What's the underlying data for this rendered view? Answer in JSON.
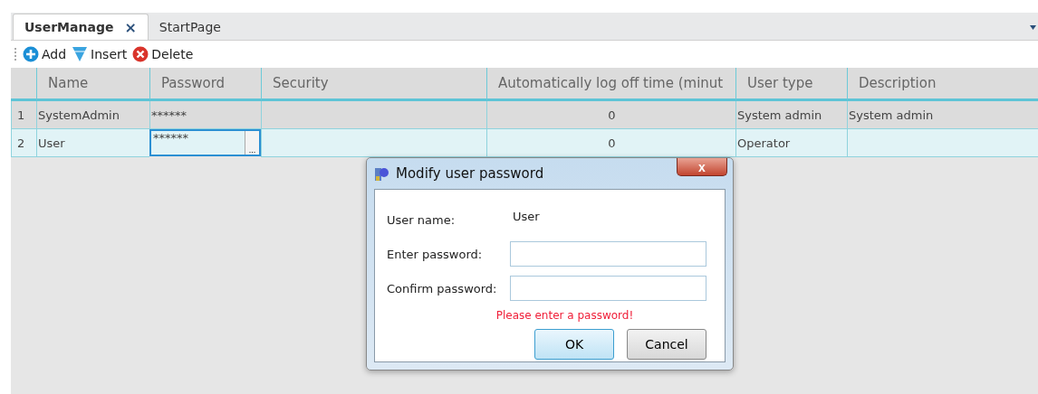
{
  "tabs": [
    {
      "label": "UserManage",
      "selected": true,
      "close": "×"
    },
    {
      "label": "StartPage",
      "selected": false
    }
  ],
  "toolbar": [
    {
      "label": "Add",
      "kind": "add"
    },
    {
      "label": "Insert",
      "kind": "insert"
    },
    {
      "label": "Delete",
      "kind": "delete"
    }
  ],
  "table": {
    "columns": [
      "Name",
      "Password",
      "Security",
      "Automatically log off time (minut",
      "User type",
      "Description"
    ],
    "rows": [
      {
        "index": "1",
        "selected": false,
        "cells": [
          {
            "text": "SystemAdmin",
            "editing": false
          },
          {
            "text": "******",
            "editing": false
          },
          {
            "text": "",
            "editing": false
          },
          {
            "text": "0",
            "editing": false
          },
          {
            "text": "System admin",
            "editing": false
          },
          {
            "text": "System admin",
            "editing": false
          }
        ]
      },
      {
        "index": "2",
        "selected": true,
        "edit_button": "...",
        "cells": [
          {
            "text": "User",
            "editing": false
          },
          {
            "text": "******",
            "editing": true
          },
          {
            "text": "",
            "editing": false
          },
          {
            "text": "0",
            "editing": false
          },
          {
            "text": "Operator",
            "editing": false
          },
          {
            "text": "",
            "editing": false
          }
        ]
      }
    ]
  },
  "dialog": {
    "title": "Modify user password",
    "close": "x",
    "fields": [
      {
        "label": "User name:",
        "kind": "value",
        "value": "User"
      },
      {
        "label": "Enter password:",
        "kind": "input"
      },
      {
        "label": "Confirm password:",
        "kind": "input"
      }
    ],
    "error": "Please enter a password!",
    "buttons": [
      {
        "label": "OK",
        "selected": true
      },
      {
        "label": "Cancel",
        "selected": false
      }
    ]
  }
}
